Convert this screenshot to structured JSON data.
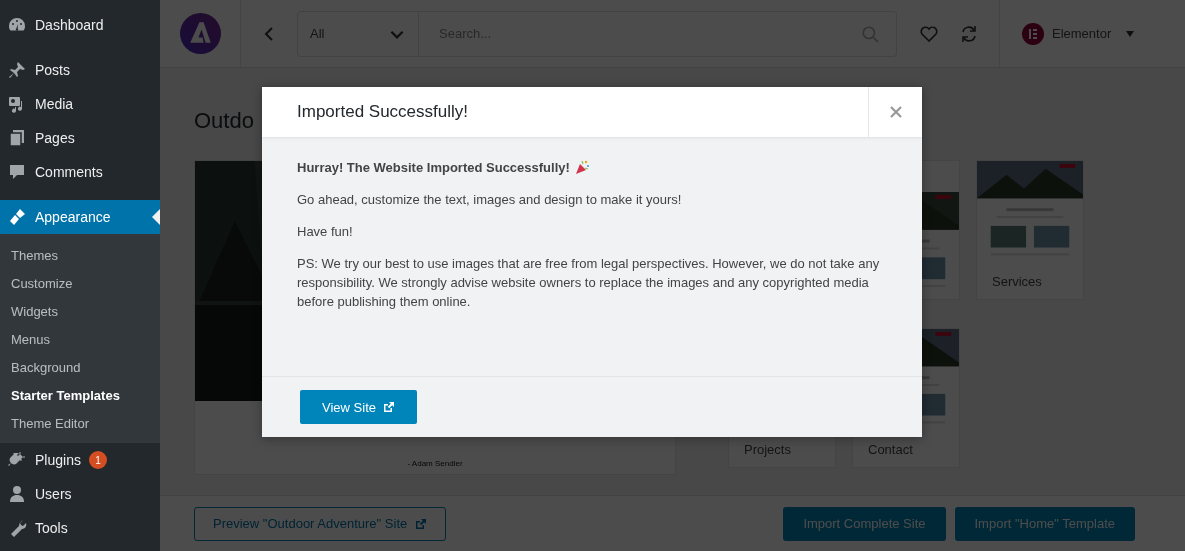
{
  "sidebar": {
    "groups": [
      [
        {
          "label": "Dashboard",
          "selected": false
        }
      ],
      [
        {
          "label": "Posts",
          "selected": false
        },
        {
          "label": "Media",
          "selected": false
        },
        {
          "label": "Pages",
          "selected": false
        },
        {
          "label": "Comments",
          "selected": false
        }
      ],
      [
        {
          "label": "Appearance",
          "selected": true,
          "children": [
            {
              "label": "Themes",
              "selected": false
            },
            {
              "label": "Customize",
              "selected": false
            },
            {
              "label": "Widgets",
              "selected": false
            },
            {
              "label": "Menus",
              "selected": false
            },
            {
              "label": "Background",
              "selected": false
            },
            {
              "label": "Starter Templates",
              "selected": true
            },
            {
              "label": "Theme Editor",
              "selected": false
            }
          ]
        },
        {
          "label": "Plugins",
          "selected": false,
          "badge": "1"
        },
        {
          "label": "Users",
          "selected": false
        },
        {
          "label": "Tools",
          "selected": false
        }
      ]
    ]
  },
  "header": {
    "filter": "All",
    "search": {
      "placeholder": "Search..."
    },
    "page_builder": "Elementor"
  },
  "page": {
    "title": "Outdo",
    "preview": {
      "kind": "picture",
      "caption": "- Adam Sendler"
    },
    "thumbnails": [
      {
        "kind": "picture"
      },
      {
        "kind": "picture",
        "label": "Services"
      },
      {
        "label": "Projects"
      },
      {
        "kind": "picture",
        "label": "Contact"
      }
    ]
  },
  "footer": {
    "preview_button": "Preview \"Outdoor Adventure\" Site",
    "buttons": [
      "Import Complete Site",
      "Import \"Home\" Template"
    ]
  },
  "modal": {
    "title": "Imported Successfully!",
    "heading": "Hurray! The Website Imported Successfully!",
    "paragraphs": [
      "Go ahead, customize the text, images and design to make it yours!",
      "Have fun!",
      "PS: We try our best to use images that are free from legal perspectives. However, we do not take any responsibility. We strongly advise website owners to replace the images and any copyrighted media before publishing them online."
    ],
    "button": "View Site"
  }
}
